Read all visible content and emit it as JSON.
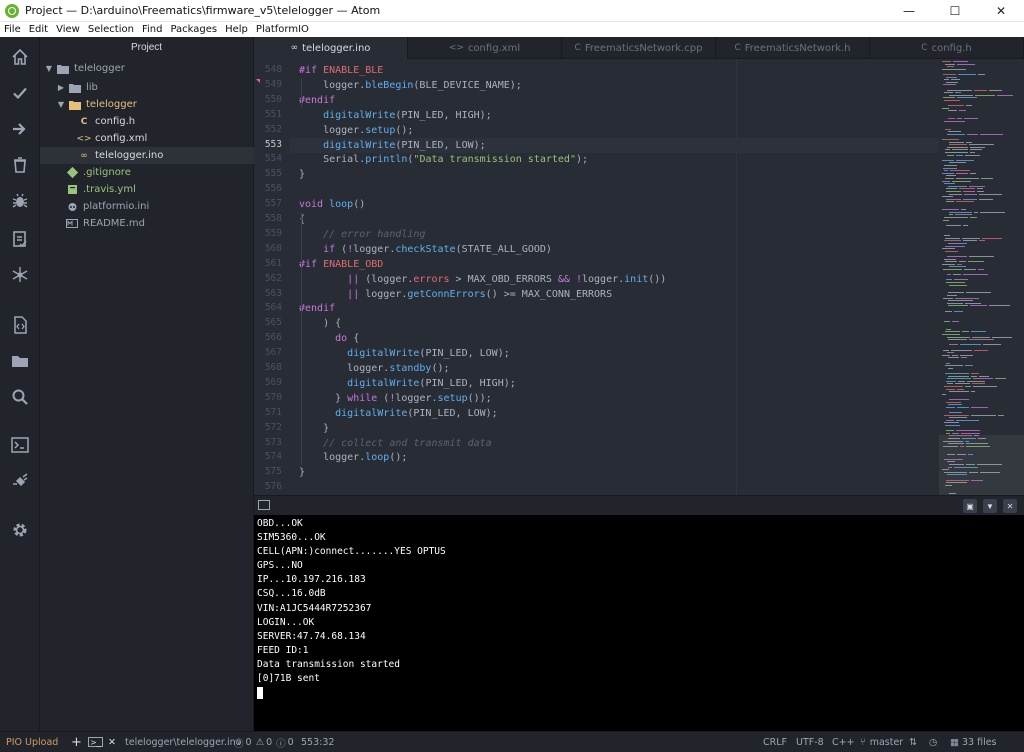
{
  "window": {
    "title": "Project — D:\\arduino\\Freematics\\firmware_v5\\telelogger — Atom",
    "minimize": "—",
    "maximize": "☐",
    "close": "✕"
  },
  "menu": [
    "File",
    "Edit",
    "View",
    "Selection",
    "Find",
    "Packages",
    "Help",
    "PlatformIO"
  ],
  "toolbar_icons": [
    "home-icon",
    "check-icon",
    "arrow-right-icon",
    "trash-icon",
    "bug-icon",
    "clipboard-check-icon",
    "network-icon",
    "code-file-icon",
    "folder-icon",
    "search-icon",
    "terminal-icon",
    "plug-icon",
    "gear-icon"
  ],
  "tree": {
    "header": "Project",
    "items": [
      {
        "label": "telelogger",
        "kind": "folder-open",
        "depth": 0
      },
      {
        "label": "lib",
        "kind": "folder",
        "depth": 1
      },
      {
        "label": "telelogger",
        "kind": "folder-open",
        "depth": 1
      },
      {
        "label": "config.h",
        "kind": "c-header",
        "depth": 2
      },
      {
        "label": "config.xml",
        "kind": "xml",
        "depth": 2
      },
      {
        "label": "telelogger.ino",
        "kind": "ino",
        "depth": 2
      },
      {
        "label": ".gitignore",
        "kind": "git",
        "depth": 1
      },
      {
        "label": ".travis.yml",
        "kind": "yml",
        "depth": 1
      },
      {
        "label": "platformio.ini",
        "kind": "pio",
        "depth": 1
      },
      {
        "label": "README.md",
        "kind": "md",
        "depth": 1
      }
    ]
  },
  "tabs": [
    {
      "label": "telelogger.ino",
      "icon": "∞"
    },
    {
      "label": "config.xml",
      "icon": "<>"
    },
    {
      "label": "FreematicsNetwork.cpp",
      "icon": "C"
    },
    {
      "label": "FreematicsNetwork.h",
      "icon": "C"
    },
    {
      "label": "config.h",
      "icon": "C"
    }
  ],
  "editor": {
    "current_line": 553,
    "lines": [
      {
        "n": 548,
        "segs": [
          [
            "#if ",
            "kw"
          ],
          [
            "ENABLE_BLE",
            "mc"
          ]
        ]
      },
      {
        "n": 549,
        "segs": [
          [
            "    logger.",
            ""
          ],
          [
            "bleBegin",
            "fn"
          ],
          [
            "(BLE_DEVICE_NAME);",
            ""
          ]
        ]
      },
      {
        "n": 550,
        "segs": [
          [
            "#endif",
            "kw"
          ]
        ]
      },
      {
        "n": 551,
        "segs": [
          [
            "    ",
            ""
          ],
          [
            "digitalWrite",
            "fn"
          ],
          [
            "(PIN_LED, HIGH);",
            ""
          ]
        ]
      },
      {
        "n": 552,
        "segs": [
          [
            "    logger.",
            ""
          ],
          [
            "setup",
            "fn"
          ],
          [
            "();",
            ""
          ]
        ]
      },
      {
        "n": 553,
        "segs": [
          [
            "    ",
            ""
          ],
          [
            "digitalWrite",
            "fn"
          ],
          [
            "(PIN_LED, LOW);",
            ""
          ]
        ]
      },
      {
        "n": 554,
        "segs": [
          [
            "    Serial.",
            ""
          ],
          [
            "println",
            "fn"
          ],
          [
            "(",
            ""
          ],
          [
            "\"Data transmission started\"",
            "str"
          ],
          [
            ");",
            ""
          ]
        ]
      },
      {
        "n": 555,
        "segs": [
          [
            "}",
            ""
          ]
        ]
      },
      {
        "n": 556,
        "segs": []
      },
      {
        "n": 557,
        "segs": [
          [
            "void ",
            "kw"
          ],
          [
            "loop",
            "fn"
          ],
          [
            "()",
            ""
          ]
        ]
      },
      {
        "n": 558,
        "segs": [
          [
            "{",
            ""
          ]
        ]
      },
      {
        "n": 559,
        "segs": [
          [
            "    ",
            ""
          ],
          [
            "// error handling",
            "cm"
          ]
        ]
      },
      {
        "n": 560,
        "segs": [
          [
            "    ",
            ""
          ],
          [
            "if ",
            "kw"
          ],
          [
            "(",
            ""
          ],
          [
            "!",
            "kw"
          ],
          [
            "logger.",
            ""
          ],
          [
            "checkState",
            "fn"
          ],
          [
            "(STATE_ALL_GOOD)",
            ""
          ]
        ]
      },
      {
        "n": 561,
        "segs": [
          [
            "#if ",
            "kw"
          ],
          [
            "ENABLE_OBD",
            "mc"
          ]
        ]
      },
      {
        "n": 562,
        "segs": [
          [
            "        ",
            ""
          ],
          [
            "|| ",
            "kw"
          ],
          [
            "(logger.",
            ""
          ],
          [
            "errors",
            "mc"
          ],
          [
            " > MAX_OBD_ERRORS ",
            ""
          ],
          [
            "&& !",
            "kw"
          ],
          [
            "logger.",
            ""
          ],
          [
            "init",
            "fn"
          ],
          [
            "())",
            ""
          ]
        ]
      },
      {
        "n": 563,
        "segs": [
          [
            "        ",
            ""
          ],
          [
            "|| ",
            "kw"
          ],
          [
            "logger.",
            ""
          ],
          [
            "getConnErrors",
            "fn"
          ],
          [
            "() >= MAX_CONN_ERRORS",
            ""
          ]
        ]
      },
      {
        "n": 564,
        "segs": [
          [
            "#endif",
            "kw"
          ]
        ]
      },
      {
        "n": 565,
        "segs": [
          [
            "    ) {",
            ""
          ]
        ]
      },
      {
        "n": 566,
        "segs": [
          [
            "      ",
            ""
          ],
          [
            "do ",
            "kw"
          ],
          [
            "{",
            ""
          ]
        ]
      },
      {
        "n": 567,
        "segs": [
          [
            "        ",
            ""
          ],
          [
            "digitalWrite",
            "fn"
          ],
          [
            "(PIN_LED, LOW);",
            ""
          ]
        ]
      },
      {
        "n": 568,
        "segs": [
          [
            "        logger.",
            ""
          ],
          [
            "standby",
            "fn"
          ],
          [
            "();",
            ""
          ]
        ]
      },
      {
        "n": 569,
        "segs": [
          [
            "        ",
            ""
          ],
          [
            "digitalWrite",
            "fn"
          ],
          [
            "(PIN_LED, HIGH);",
            ""
          ]
        ]
      },
      {
        "n": 570,
        "segs": [
          [
            "      } ",
            ""
          ],
          [
            "while ",
            "kw"
          ],
          [
            "(",
            ""
          ],
          [
            "!",
            "kw"
          ],
          [
            "logger.",
            ""
          ],
          [
            "setup",
            "fn"
          ],
          [
            "());",
            ""
          ]
        ]
      },
      {
        "n": 571,
        "segs": [
          [
            "      ",
            ""
          ],
          [
            "digitalWrite",
            "fn"
          ],
          [
            "(PIN_LED, LOW);",
            ""
          ]
        ]
      },
      {
        "n": 572,
        "segs": [
          [
            "    }",
            ""
          ]
        ]
      },
      {
        "n": 573,
        "segs": [
          [
            "    ",
            ""
          ],
          [
            "// collect and transmit data",
            "cm"
          ]
        ]
      },
      {
        "n": 574,
        "segs": [
          [
            "    logger.",
            ""
          ],
          [
            "loop",
            "fn"
          ],
          [
            "();",
            ""
          ]
        ]
      },
      {
        "n": 575,
        "segs": [
          [
            "}",
            ""
          ]
        ]
      },
      {
        "n": 576,
        "segs": []
      }
    ]
  },
  "terminal": {
    "lines": [
      "OBD...OK",
      "SIM5360...OK",
      "CELL(APN:)connect.......YES OPTUS",
      "GPS...NO",
      "IP...10.197.216.183",
      "CSQ...16.0dB",
      "VIN:A1JC5444R7252367",
      "LOGIN...OK",
      "SERVER:47.74.68.134",
      "FEED ID:1",
      "Data transmission started",
      "[0]71B sent"
    ]
  },
  "status": {
    "pio_upload": "PIO Upload",
    "add": "+",
    "terminal_icon": ">_",
    "close": "✕",
    "file_path": "telelogger\\telelogger.ino",
    "errors": "0",
    "warnings": "0",
    "infos": "0",
    "cursor": "553:32",
    "line_ending": "CRLF",
    "encoding": "UTF-8",
    "grammar": "C++",
    "branch": "master",
    "files": "33 files"
  },
  "colors": {
    "bg": "#282c34",
    "panel": "#21252b",
    "keyword": "#c678dd",
    "function": "#61afef",
    "member": "#e06c75",
    "string": "#98c379",
    "comment": "#5c6370",
    "atom_green": "#66b32e",
    "pio_accent": "#d19a66"
  }
}
